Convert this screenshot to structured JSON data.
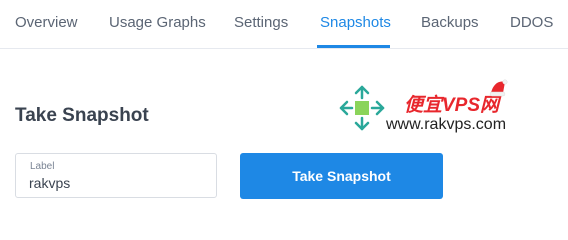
{
  "tabs": [
    {
      "label": "Overview",
      "active": false
    },
    {
      "label": "Usage Graphs",
      "active": false
    },
    {
      "label": "Settings",
      "active": false
    },
    {
      "label": "Snapshots",
      "active": true
    },
    {
      "label": "Backups",
      "active": false
    },
    {
      "label": "DDOS",
      "active": false
    }
  ],
  "section": {
    "title": "Take Snapshot"
  },
  "form": {
    "label_field": {
      "label": "Label",
      "value": "rakvps"
    },
    "submit_label": "Take Snapshot"
  },
  "watermark": {
    "brand_cn": "便宜VPS网",
    "url": "www.rakvps.com"
  },
  "colors": {
    "accent": "#1e88e5",
    "tab_text": "#5b6574",
    "title_text": "#3a4350",
    "watermark_red": "#e8272d",
    "arrow_teal": "#2aa89a",
    "center_green": "#8bd45a"
  },
  "icons": {
    "watermark_logo": "four-way-arrows-icon",
    "holiday_hat": "santa-hat-icon"
  }
}
